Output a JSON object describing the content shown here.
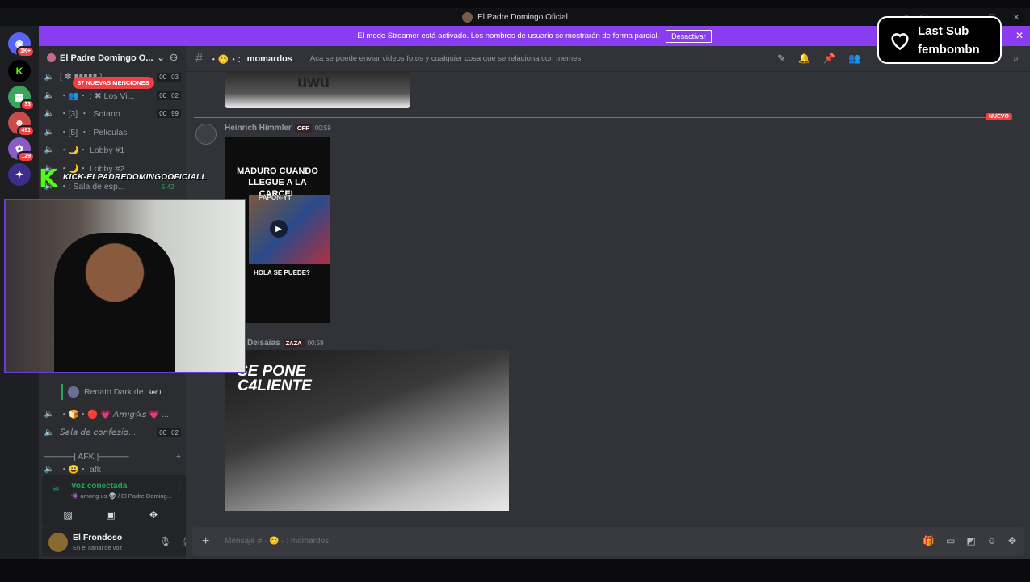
{
  "window": {
    "title": "El Padre Domingo Oficial"
  },
  "streamer_banner": {
    "text": "El modo Streamer está activado. Los nombres de usuario se mostrarán de forma parcial.",
    "button": "Desactivar"
  },
  "guilds": [
    {
      "badge": "1K+",
      "color": "#5865f2"
    },
    {
      "badge": "",
      "color": "#53fc18"
    },
    {
      "badge": "33",
      "color": "#3ba55d"
    },
    {
      "badge": "491",
      "color": "#c94a4a"
    },
    {
      "badge": "129",
      "color": "#8a5cc7"
    },
    {
      "badge": "",
      "color": "#3f2d8a"
    }
  ],
  "server": {
    "name": "El Padre Domingo O..."
  },
  "mentions_pill": "37 NUEVAS MENCIONES",
  "channels": [
    {
      "name": "[ ✽ ▮▮▮▮▮ ]",
      "a": "00",
      "b": "03"
    },
    {
      "name": "・👥・ : ✖ Los Vi...",
      "a": "00",
      "b": "02"
    },
    {
      "name": "・[3] ・: Sotano",
      "a": "00",
      "b": "99"
    },
    {
      "name": "・[5] ・: Peliculas",
      "a": "",
      "b": ""
    },
    {
      "name": "・🌙・ Lobby #1",
      "a": "",
      "b": ""
    },
    {
      "name": "・🌙・ Lobby #2",
      "a": "",
      "b": ""
    },
    {
      "name": "・: Sala de esp...",
      "a": "",
      "b": ""
    }
  ],
  "voice_user": {
    "name": "Renato Dark de",
    "tag": "ser0"
  },
  "channels_lower": [
    {
      "name": "・🍞・🔴 💗 𝘈𝘮𝘪𝘨✰𝘴 💗 ...",
      "a": "",
      "b": ""
    },
    {
      "name": "𝘚𝘢𝘭𝘢 𝘥𝘦 𝘤𝘰𝘯𝘧𝘦𝘴𝘪𝘰...",
      "a": "00",
      "b": "02"
    },
    {
      "name": "─────| AFK |─────",
      "a": "",
      "b": ""
    },
    {
      "name": "・😀・ afk",
      "a": "",
      "b": ""
    }
  ],
  "voice": {
    "status": "Voz conectada",
    "sub": "👾 among us 👽 / El Padre Doming..."
  },
  "user": {
    "name": "El Frondoso",
    "status": "En el canal de voz"
  },
  "channel": {
    "name": "momardos",
    "topic": "Aca se puede enviar videos fotos y cualquier cosa que se relaciona con memes"
  },
  "new_tag": "NUEVO",
  "messages": [
    {
      "author": "Heinrich Himmler",
      "role": "OFF",
      "time": "00:59",
      "card_title": "MADURO CUANDO LLEGUE A LA CARCEL",
      "card_sub": "PAPON-YT",
      "card_caption": "HOLA SE PUEDE?"
    },
    {
      "author": "Deisaias",
      "role": "ZAZA",
      "time": "00:59",
      "overlay": "SE PONE C4LIENTE"
    }
  ],
  "top_image_text": "uwu",
  "composer": {
    "placeholder": "Mensaje # · 😊 · : momardos"
  },
  "overlay": {
    "line1": "Last Sub",
    "line2": "fembombn"
  },
  "kick": {
    "handle": "KICK-ELPADREDOMINGOOFICIALL",
    "timer": "5:42"
  }
}
